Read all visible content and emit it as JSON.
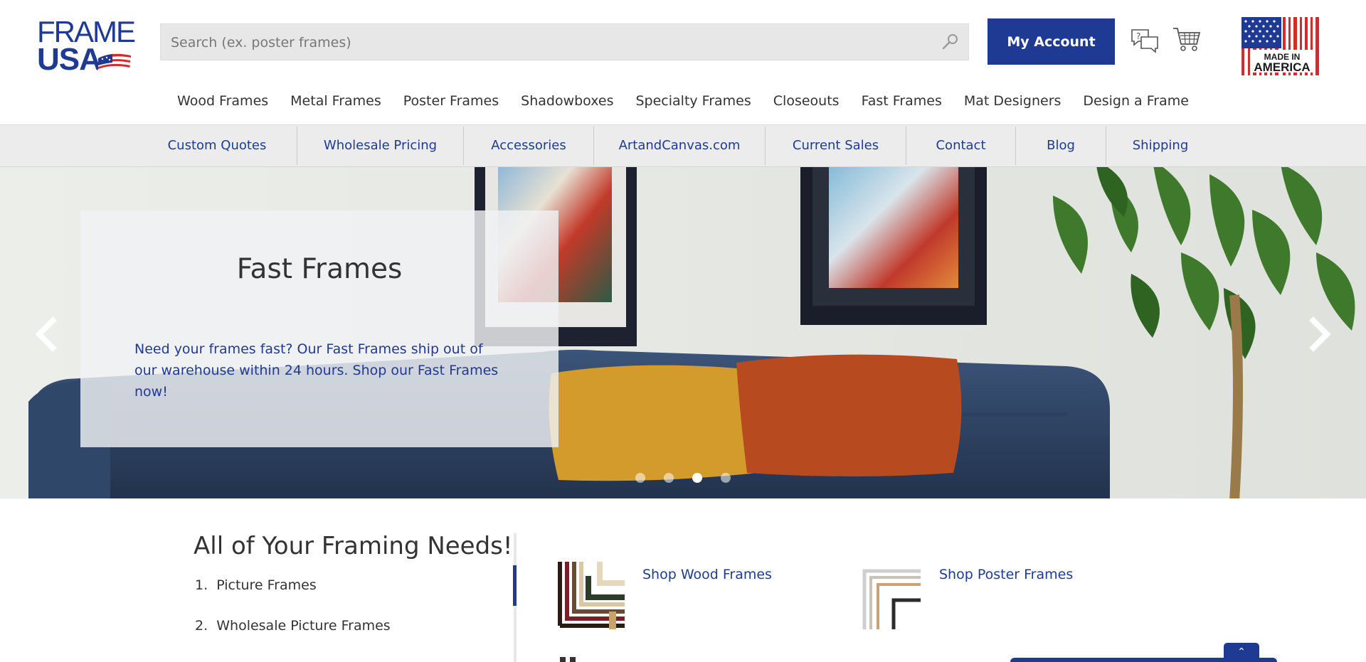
{
  "header": {
    "logo": {
      "line1": "FRAME",
      "line2": "USA"
    },
    "search": {
      "placeholder": "Search (ex. poster frames)",
      "icon": "search-icon"
    },
    "account_button": "My Account",
    "icons": [
      "chat-help-icon",
      "cart-icon"
    ],
    "badge": {
      "line1": "MADE IN",
      "line2": "AMERICA"
    }
  },
  "main_nav": [
    {
      "label": "Wood Frames"
    },
    {
      "label": "Metal Frames"
    },
    {
      "label": "Poster Frames"
    },
    {
      "label": "Shadowboxes"
    },
    {
      "label": "Specialty Frames"
    },
    {
      "label": "Closeouts"
    },
    {
      "label": "Fast Frames"
    },
    {
      "label": "Mat Designers"
    },
    {
      "label": "Design a Frame"
    }
  ],
  "sub_nav": [
    {
      "label": "Custom Quotes"
    },
    {
      "label": "Wholesale Pricing"
    },
    {
      "label": "Accessories"
    },
    {
      "label": "ArtandCanvas.com"
    },
    {
      "label": "Current Sales"
    },
    {
      "label": "Contact"
    },
    {
      "label": "Blog"
    },
    {
      "label": "Shipping"
    }
  ],
  "hero": {
    "title": "Fast Frames",
    "text": "Need your frames fast? Our Fast Frames ship out of our warehouse within 24 hours. Shop our Fast Frames now!",
    "slide_count": 4,
    "active_slide": 3
  },
  "needs": {
    "heading": "All of Your Framing Needs!",
    "items": [
      {
        "num": "1.",
        "label": "Picture Frames"
      },
      {
        "num": "2.",
        "label": "Wholesale Picture Frames"
      }
    ]
  },
  "products": [
    {
      "label": "Shop Wood Frames"
    },
    {
      "label": "Shop Poster Frames"
    }
  ],
  "chat_tab": "⌃",
  "colors": {
    "brand_blue": "#1f3a93",
    "subnav_bg": "#ececec",
    "search_bg": "#e7e7e7"
  }
}
